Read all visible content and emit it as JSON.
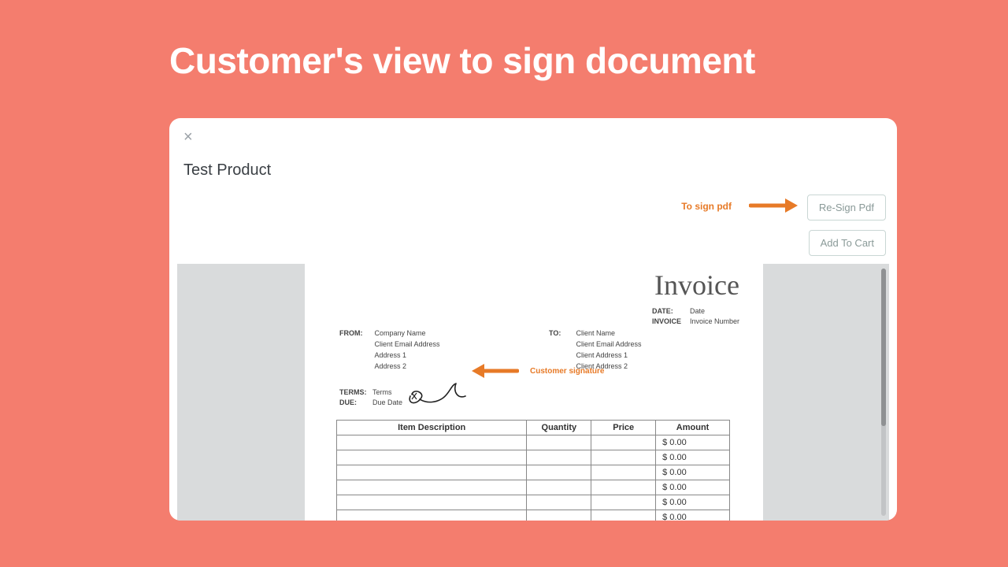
{
  "page_title": "Customer's view to sign document",
  "modal": {
    "close_glyph": "×",
    "product_name": "Test Product",
    "buttons": {
      "resign": "Re-Sign Pdf",
      "add_to_cart": "Add To Cart"
    }
  },
  "annotations": {
    "to_sign_pdf": "To sign pdf",
    "customer_signature": "Customer signature"
  },
  "invoice": {
    "title": "Invoice",
    "meta": {
      "date_label": "DATE:",
      "date_value": "Date",
      "invoice_label": "INVOICE",
      "invoice_value": "Invoice Number"
    },
    "from": {
      "label": "FROM:",
      "lines": [
        "Company Name",
        "Client Email Address",
        "Address 1",
        "Address 2"
      ]
    },
    "to": {
      "label": "TO:",
      "lines": [
        "Client Name",
        "Client Email Address",
        "Client Address 1",
        "Client Address 2"
      ]
    },
    "terms": {
      "terms_label": "TERMS:",
      "terms_value": "Terms",
      "due_label": "DUE:",
      "due_value": "Due Date"
    },
    "table": {
      "headers": [
        "Item Description",
        "Quantity",
        "Price",
        "Amount"
      ],
      "rows": [
        {
          "desc": "",
          "qty": "",
          "price": "",
          "amount": "$ 0.00"
        },
        {
          "desc": "",
          "qty": "",
          "price": "",
          "amount": "$ 0.00"
        },
        {
          "desc": "",
          "qty": "",
          "price": "",
          "amount": "$ 0.00"
        },
        {
          "desc": "",
          "qty": "",
          "price": "",
          "amount": "$ 0.00"
        },
        {
          "desc": "",
          "qty": "",
          "price": "",
          "amount": "$ 0.00"
        },
        {
          "desc": "",
          "qty": "",
          "price": "",
          "amount": "$ 0.00"
        }
      ]
    }
  },
  "colors": {
    "background": "#f47d6e",
    "accent": "#e77a27"
  }
}
